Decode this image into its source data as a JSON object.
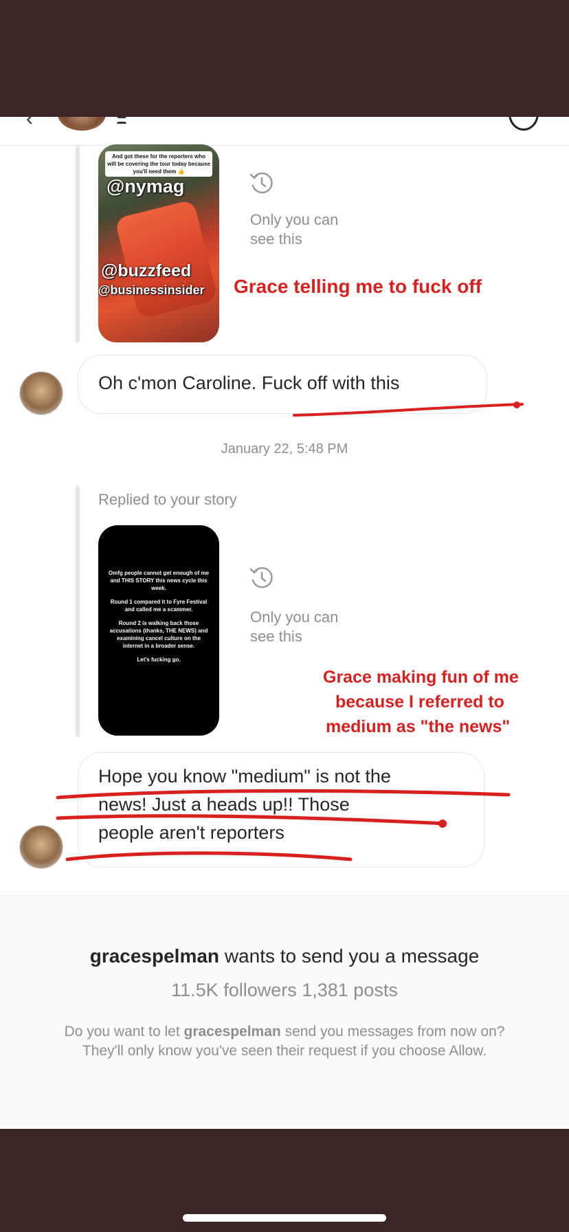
{
  "header": {
    "back_icon": "chevron-left-icon",
    "info_icon": "info-icon"
  },
  "story1": {
    "top_note": "And got these for the reporters who will be covering the tour today because you'll need them 👍",
    "tag1": "@nymag",
    "tag2": "@buzzfeed",
    "tag3": "@businessinsider",
    "status_text": "Only you can\nsee this"
  },
  "annotations": {
    "a1": "Grace telling me to fuck off",
    "a2_line1": "Grace making fun of me",
    "a2_line2": "because I referred to",
    "a2_line3": "medium as \"the news\""
  },
  "message1": {
    "text": "Oh c'mon Caroline. Fuck off with this"
  },
  "timestamp": "January 22, 5:48 PM",
  "story2": {
    "replied_label": "Replied to your story",
    "p1": "Omfg people cannot get enough of me and THIS STORY this news cycle this week.",
    "p2": "Round 1 compared it to Fyre Festival and called me a scammer.",
    "p3": "Round 2 is walking back those accusations (thanks, THE NEWS) and examining cancel culture on the internet in a broader sense.",
    "p4": "Let's fucking go.",
    "status_text": "Only you can\nsee this"
  },
  "message2": {
    "line1": "Hope you know \"medium\" is not the",
    "line2": "news! Just a heads up!! Those",
    "line3": "people aren't reporters"
  },
  "request": {
    "username": "gracespelman",
    "title_rest": " wants to send you a message",
    "stats": "11.5K followers 1,381 posts",
    "body_pre": "Do you want to let ",
    "body_user": "gracespelman",
    "body_post": " send you messages from now on? They'll only know you've seen their request if you choose Allow."
  },
  "colors": {
    "annotation_red": "#d8201f",
    "frame_brown": "#3c2526",
    "secondary_text": "#8e8e8e"
  }
}
